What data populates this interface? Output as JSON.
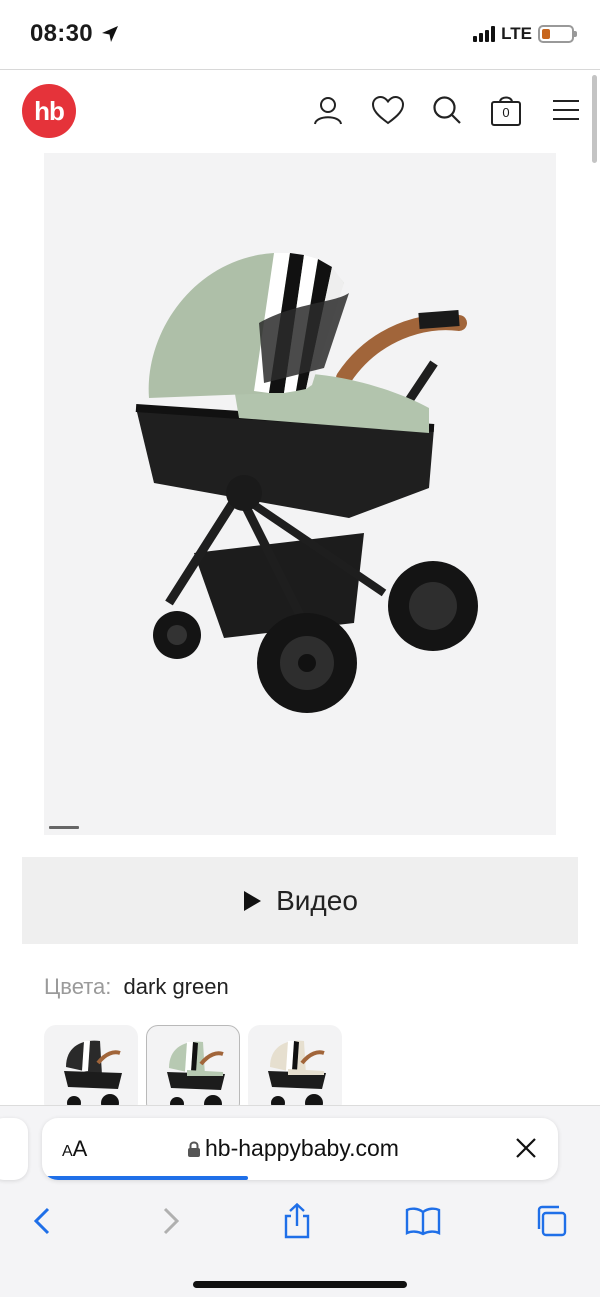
{
  "status_bar": {
    "time": "08:30",
    "network": "LTE",
    "battery_level": 0.3,
    "battery_color": "#c7651d"
  },
  "header": {
    "logo_text": "hb",
    "logo_color": "#e5333a",
    "icons": [
      "user-icon",
      "heart-icon",
      "search-icon",
      "cart-icon",
      "menu-icon"
    ],
    "cart_count": "0"
  },
  "product": {
    "image_alt_icon": "stroller-image",
    "slide_index": 1
  },
  "video_button": {
    "label": "Видео",
    "icon": "play-icon"
  },
  "colors": {
    "label": "Цвета:",
    "selected": "dark green",
    "swatches": [
      {
        "variant": "black",
        "hood": "#2a2a2a"
      },
      {
        "variant": "dark green",
        "hood": "#b7c9b2",
        "selected": true
      },
      {
        "variant": "beige",
        "hood": "#e6dfcf"
      }
    ]
  },
  "browser": {
    "text_size_label_small": "A",
    "text_size_label_large": "A",
    "url": "hb-happybaby.com",
    "load_progress": 0.4,
    "accent": "#1f6fe8",
    "toolbar_icons": [
      "back-icon",
      "forward-icon",
      "share-icon",
      "bookmarks-icon",
      "tabs-icon"
    ]
  }
}
